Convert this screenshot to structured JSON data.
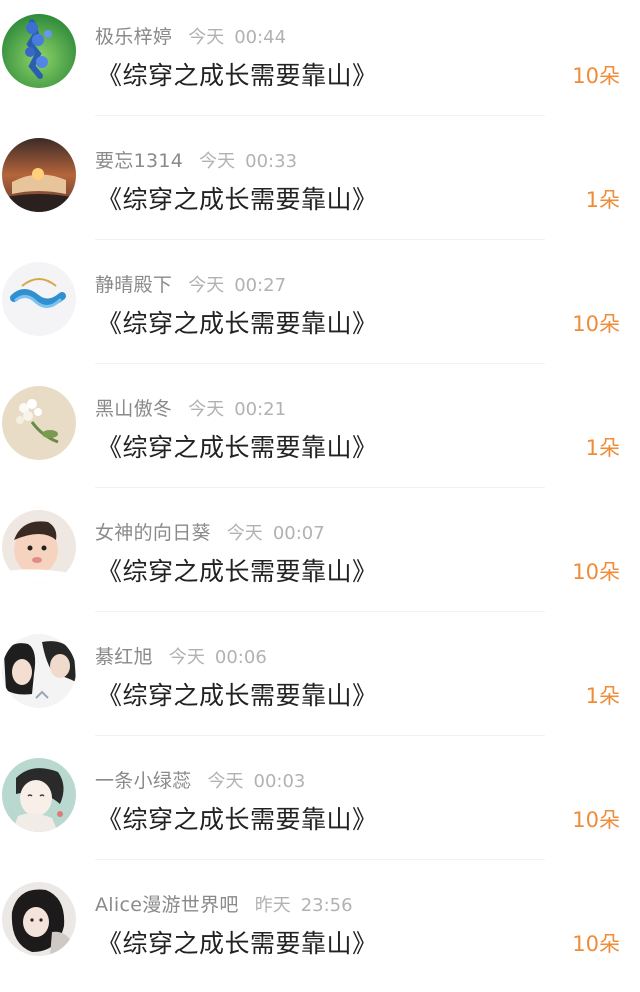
{
  "entries": [
    {
      "username": "极乐梓婷",
      "day": "今天",
      "time": "00:44",
      "title": "《综穿之成长需要靠山》",
      "gift": "10朵",
      "avatar_icon": "blue-flower-avatar"
    },
    {
      "username": "要忘1314",
      "day": "今天",
      "time": "00:33",
      "title": "《综穿之成长需要靠山》",
      "gift": "1朵",
      "avatar_icon": "sunset-hand-avatar"
    },
    {
      "username": "静晴殿下",
      "day": "今天",
      "time": "00:27",
      "title": "《综穿之成长需要靠山》",
      "gift": "10朵",
      "avatar_icon": "bracelet-avatar"
    },
    {
      "username": "黑山傲冬",
      "day": "今天",
      "time": "00:21",
      "title": "《综穿之成长需要靠山》",
      "gift": "1朵",
      "avatar_icon": "white-flowers-avatar"
    },
    {
      "username": "女神的向日葵",
      "day": "今天",
      "time": "00:07",
      "title": "《综穿之成长需要靠山》",
      "gift": "10朵",
      "avatar_icon": "baby-avatar"
    },
    {
      "username": "綦红旭",
      "day": "今天",
      "time": "00:06",
      "title": "《综穿之成长需要靠山》",
      "gift": "1朵",
      "avatar_icon": "couple-avatar"
    },
    {
      "username": "一条小绿蕊",
      "day": "今天",
      "time": "00:03",
      "title": "《综穿之成长需要靠山》",
      "gift": "10朵",
      "avatar_icon": "drawn-girl-avatar"
    },
    {
      "username": "Alice漫游世界吧",
      "day": "昨天",
      "time": "23:56",
      "title": "《综穿之成长需要靠山》",
      "gift": "10朵",
      "avatar_icon": "dark-hair-girl-avatar"
    }
  ]
}
